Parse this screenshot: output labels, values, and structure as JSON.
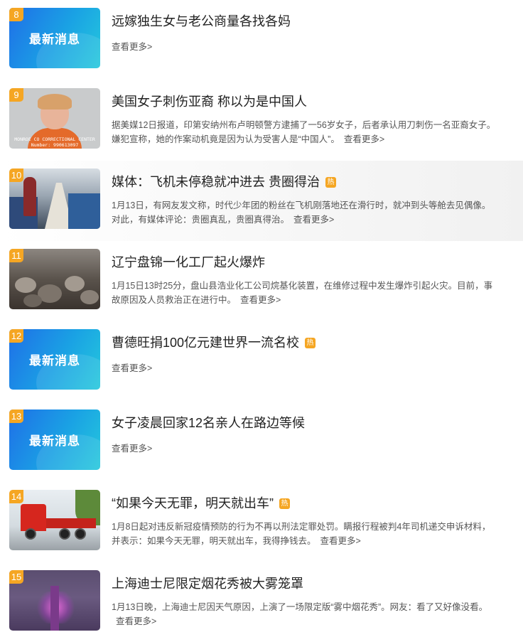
{
  "placeholder_text": "最新消息",
  "mug_caption": [
    "MONROE CO CORRECTIONAL CENTER",
    "Number: 990613097"
  ],
  "hot_label": "热",
  "colors": {
    "rank_badge": "#f5a623",
    "hot_badge": "#f5a623",
    "placeholder_bg": "#1aa2e4"
  },
  "items": [
    {
      "rank": "8",
      "title": "远嫁独生女与老公商量各找各妈",
      "summary": "",
      "more": "查看更多>",
      "hot": false,
      "image": "latest-news-placeholder"
    },
    {
      "rank": "9",
      "title": "美国女子刺伤亚裔 称以为是中国人",
      "summary": "据美媒12日报道，印第安纳州布卢明顿警方逮捕了一56岁女子，后者承认用刀刺伤一名亚裔女子。嫌犯宣称，她的作案动机竟是因为认为受害人是“中国人”。",
      "more": "查看更多>",
      "hot": false,
      "image": "mugshot-photo"
    },
    {
      "rank": "10",
      "title": "媒体：飞机未停稳就冲进去 贵圈得治",
      "summary": "1月13日，有网友发文称，时代少年团的粉丝在飞机刚落地还在滑行时，就冲到头等舱去见偶像。对此，有媒体评论：贵圈真乱，贵圈真得治。",
      "more": "查看更多>",
      "hot": true,
      "image": "plane-cabin-photo"
    },
    {
      "rank": "11",
      "title": "辽宁盘锦一化工厂起火爆炸",
      "summary": "1月15日13时25分，盘山县浩业化工公司烷基化装置，在维修过程中发生爆炸引起火灾。目前，事故原因及人员救治正在进行中。",
      "more": "查看更多>",
      "hot": false,
      "image": "explosion-debris-photo"
    },
    {
      "rank": "12",
      "title": "曹德旺捐100亿元建世界一流名校",
      "summary": "",
      "more": "查看更多>",
      "hot": true,
      "image": "latest-news-placeholder"
    },
    {
      "rank": "13",
      "title": "女子凌晨回家12名亲人在路边等候",
      "summary": "",
      "more": "查看更多>",
      "hot": false,
      "image": "latest-news-placeholder"
    },
    {
      "rank": "14",
      "title": "“如果今天无罪，明天就出车”",
      "summary": "1月8日起对违反新冠疫情预防的行为不再以刑法定罪处罚。瞒报行程被判4年司机递交申诉材料，并表示：如果今天无罪，明天就出车，我得挣钱去。",
      "more": "查看更多>",
      "hot": true,
      "image": "red-truck-photo"
    },
    {
      "rank": "15",
      "title": "上海迪士尼限定烟花秀被大雾笼罩",
      "summary": "1月13日晚，上海迪士尼因天气原因，上演了一场限定版“雾中烟花秀”。网友：看了又好像没看。",
      "more": "查看更多>",
      "hot": false,
      "image": "castle-fireworks-photo"
    }
  ]
}
